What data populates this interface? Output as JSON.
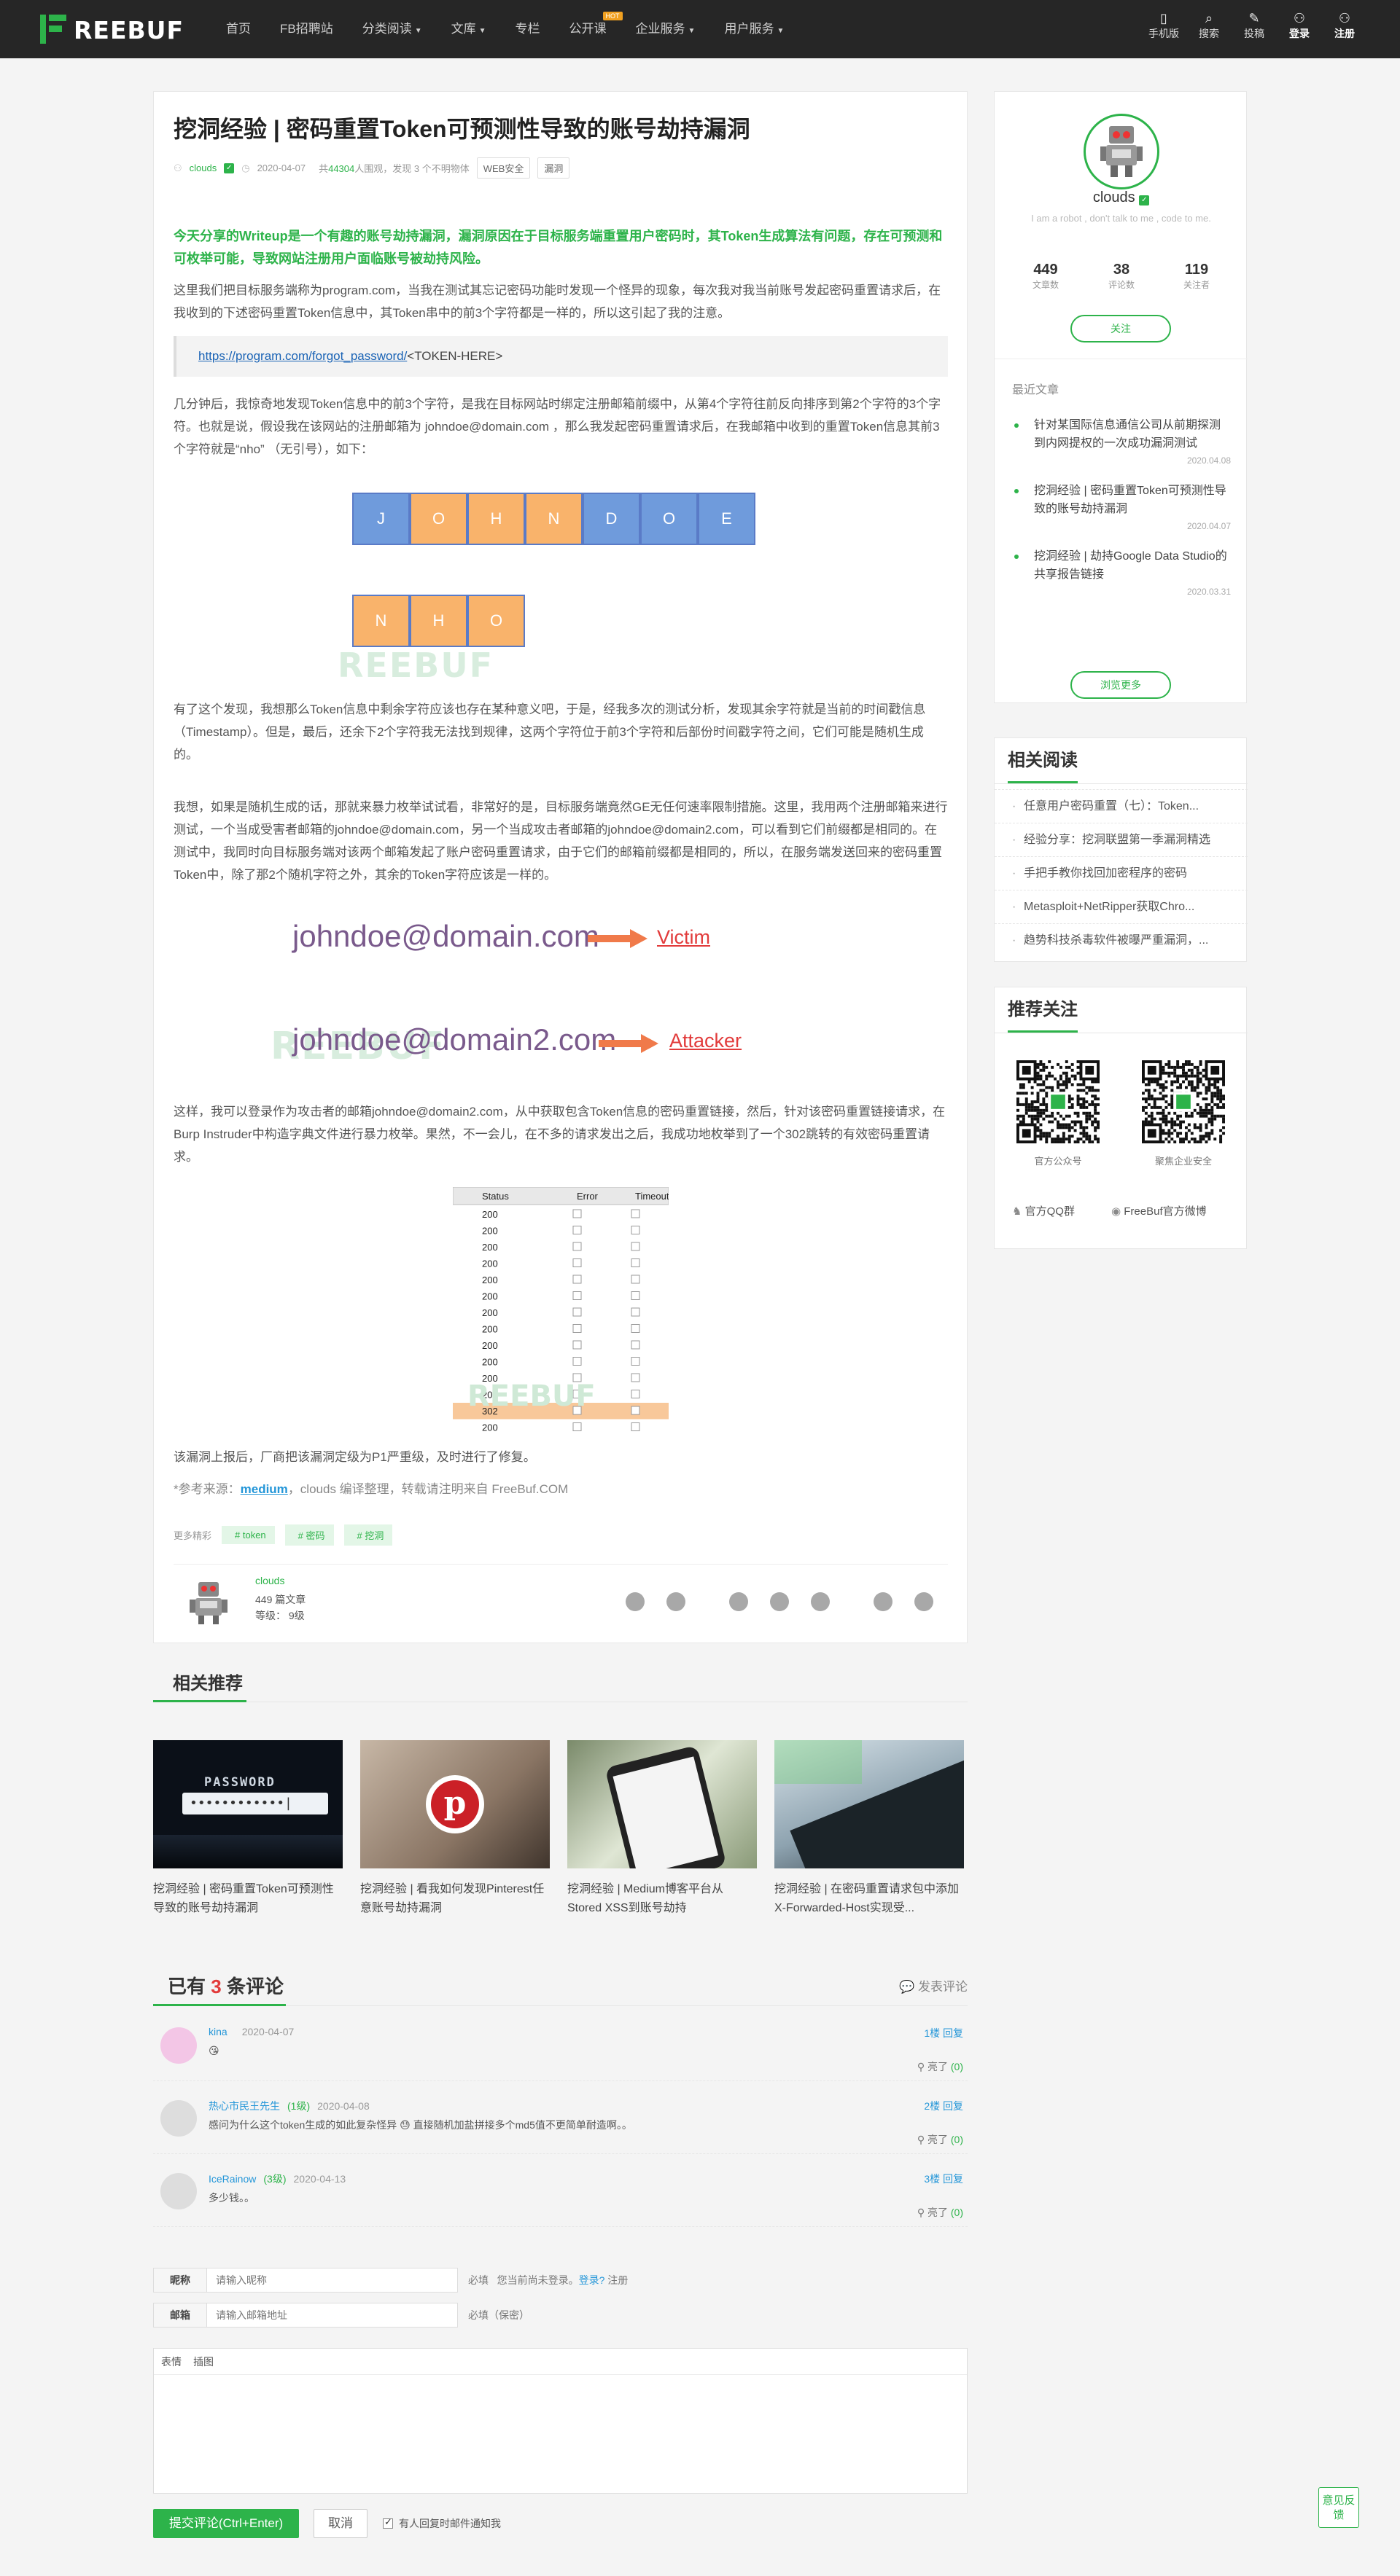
{
  "brand": {
    "name": "REEBUF",
    "accent": "#2db34a"
  },
  "nav": {
    "items": [
      "首页",
      "FB招聘站",
      "分类阅读",
      "文库",
      "专栏",
      "公开课",
      "企业服务",
      "用户服务"
    ],
    "hot_badge": "HOT"
  },
  "toolbar": {
    "mobile": "手机版",
    "search": "搜索",
    "submit": "投稿",
    "login": "登录",
    "register": "注册"
  },
  "article": {
    "title": "挖洞经验 | 密码重置Token可预测性导致的账号劫持漏洞",
    "author": "clouds",
    "date": "2020-04-07",
    "views_prefix": "共",
    "views": "44304",
    "views_suffix": "人围观，发现",
    "comments_count": "3",
    "comments_suffix": "个不明物体",
    "tags": [
      "WEB安全",
      "漏洞"
    ],
    "intro": "今天分享的Writeup是一个有趣的账号劫持漏洞，漏洞原因在于目标服务端重置用户密码时，其Token生成算法有问题，存在可预测和可枚举可能，导致网站注册用户面临账号被劫持风险。",
    "p1": "这里我们把目标服务端称为program.com，当我在测试其忘记密码功能时发现一个怪异的现象，每次我对我当前账号发起密码重置请求后，在我收到的下述密码重置Token信息中，其Token串中的前3个字符都是一样的，所以这引起了我的注意。",
    "link": "https://program.com/forgot_password/",
    "link_tail": "<TOKEN-HERE>",
    "p2": "几分钟后，我惊奇地发现Token信息中的前3个字符，是我在目标网站时绑定注册邮箱前缀中，从第4个字符往前反向排序到第2个字符的3个字符。也就是说，假设我在该网站的注册邮箱为 johndoe@domain.com ，那么我发起密码重置请求后，在我邮箱中收到的重置Token信息其前3个字符就是“nho” （无引号），如下：",
    "boxes_top": [
      "J",
      "O",
      "H",
      "N",
      "D",
      "O",
      "E"
    ],
    "boxes_bottom": [
      "N",
      "H",
      "O"
    ],
    "p3": "有了这个发现，我想那么Token信息中剩余字符应该也存在某种意义吧，于是，经我多次的测试分析，发现其余字符就是当前的时间戳信息（Timestamp）。但是，最后，还余下2个字符我无法找到规律，这两个字符位于前3个字符和后部份时间戳字符之间，它们可能是随机生成的。",
    "p4": "我想，如果是随机生成的话，那就来暴力枚举试试看，非常好的是，目标服务端竟然GE无任何速率限制措施。这里，我用两个注册邮箱来进行测试，一个当成受害者邮箱的johndoe@domain.com，另一个当成攻击者邮箱的johndoe@domain2.com，可以看到它们前缀都是相同的。在测试中，我同时向目标服务端对该两个邮箱发起了账户密码重置请求，由于它们的邮箱前缀都是相同的，所以，在服务端发送回来的密码重置Token中，除了那2个随机字符之外，其余的Token字符应该是一样的。",
    "email_victim": "johndoe@domain.com",
    "label_victim": "Victim",
    "email_attacker": "johndoe@domain2.com",
    "label_attacker": "Attacker",
    "p5": "这样，我可以登录作为攻击者的邮箱johndoe@domain2.com，从中获取包含Token信息的密码重置链接，然后，针对该密码重置链接请求，在Burp Instruder中构造字典文件进行暴力枚举。果然，不一会儿，在不多的请求发出之后，我成功地枚举到了一个302跳转的有效密码重置请求。",
    "table_headers": [
      "Status",
      "Error",
      "Timeout"
    ],
    "table_rows": [
      "200",
      "200",
      "200",
      "200",
      "200",
      "200",
      "200",
      "200",
      "200",
      "200",
      "200",
      "200",
      "302",
      "200"
    ],
    "p6": "该漏洞上报后，厂商把该漏洞定级为P1严重级，及时进行了修复。",
    "ref_prefix": "*参考来源：",
    "ref_link": "medium",
    "ref_suffix": "，clouds 编译整理，转载请注明来自 FreeBuf.COM",
    "more_label": "更多精彩",
    "more_tags": [
      "token",
      "密码",
      "挖洞"
    ],
    "author_card": {
      "name": "clouds",
      "articles": "449 篇文章",
      "level": "等级：  9级"
    }
  },
  "watermark": "REEBUF",
  "sidebar": {
    "profile": {
      "name": "clouds",
      "desc": "I am a robot , don't talk to me , code to me.",
      "stats": [
        {
          "v": "449",
          "l": "文章数"
        },
        {
          "v": "38",
          "l": "评论数"
        },
        {
          "v": "119",
          "l": "关注者"
        }
      ],
      "follow": "关注"
    },
    "recent_title": "最近文章",
    "recent": [
      {
        "title": "针对某国际信息通信公司从前期探测到内网提权的一次成功漏洞测试",
        "date": "2020.04.08"
      },
      {
        "title": "挖洞经验 | 密码重置Token可预测性导致的账号劫持漏洞",
        "date": "2020.04.07"
      },
      {
        "title": "挖洞经验 | 劫持Google Data Studio的共享报告链接",
        "date": "2020.03.31"
      }
    ],
    "browse_more": "浏览更多",
    "related_title": "相关阅读",
    "related": [
      "任意用户密码重置（七）：Token...",
      "经验分享：挖洞联盟第一季漏洞精选",
      "手把手教你找回加密程序的密码",
      "Metasploit+NetRipper获取Chro...",
      "趋势科技杀毒软件被曝严重漏洞，..."
    ],
    "follow_title": "推荐关注",
    "qr1": "官方公众号",
    "qr2": "聚焦企业安全",
    "qq": "官方QQ群",
    "weibo": "FreeBuf官方微博"
  },
  "related_recommend": {
    "title": "相关推荐",
    "items": [
      "挖洞经验 | 密码重置Token可预测性导致的账号劫持漏洞",
      "挖洞经验 | 看我如何发现Pinterest任意账号劫持漏洞",
      "挖洞经验 | Medium博客平台从Stored XSS到账号劫持",
      "挖洞经验 | 在密码重置请求包中添加X-Forwarded-Host实现受..."
    ],
    "password_text": "PASSWORD",
    "password_dots": "••••••••••••|"
  },
  "comments": {
    "heading_prefix": "已有",
    "count": "3",
    "heading_suffix": "条评论",
    "post_link": "发表评论",
    "items": [
      {
        "name": "kina",
        "level": "",
        "date": "2020-04-07",
        "text": "😘",
        "floor": "1楼",
        "reply": "回复",
        "like": "亮了",
        "likes": "(0)"
      },
      {
        "name": "热心市民王先生",
        "level": "(1级)",
        "date": "2020-04-08",
        "text": "感问为什么这个token生成的如此复杂怪异 😓 直接随机加盐拼接多个md5值不更简单耐造啊。。",
        "floor": "2楼",
        "reply": "回复",
        "like": "亮了",
        "likes": "(0)"
      },
      {
        "name": "IceRainow",
        "level": "(3级)",
        "date": "2020-04-13",
        "text": "多少钱。。",
        "floor": "3楼",
        "reply": "回复",
        "like": "亮了",
        "likes": "(0)"
      }
    ]
  },
  "form": {
    "nick_label": "昵称",
    "nick_placeholder": "请输入昵称",
    "nick_note": "必填",
    "login_note_a": "您当前尚未登录。",
    "login_link": "登录?",
    "register": "注册",
    "email_label": "邮箱",
    "email_placeholder": "请输入邮箱地址",
    "email_note": "必填（保密）",
    "tb_emoji": "表情",
    "tb_image": "插图",
    "submit": "提交评论(Ctrl+Enter)",
    "cancel": "取消",
    "notify": "有人回复时邮件通知我"
  },
  "feedback": "意见反馈"
}
